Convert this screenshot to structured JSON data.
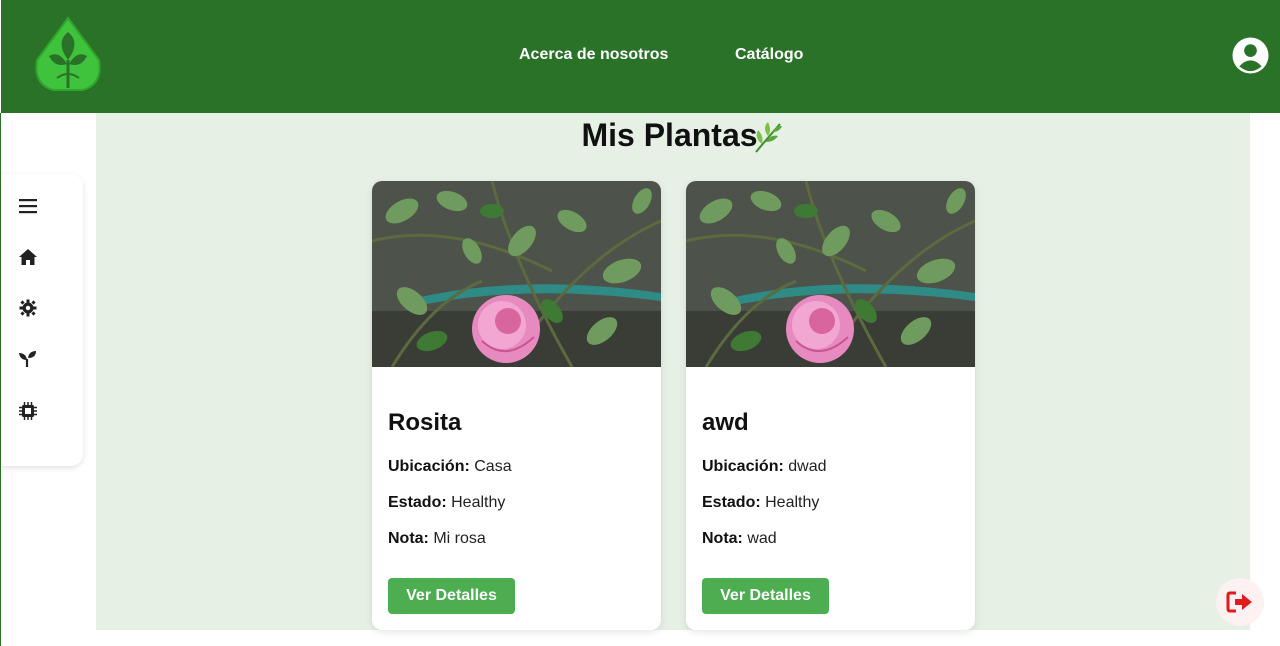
{
  "nav": {
    "about_label": "Acerca de nosotros",
    "catalog_label": "Catálogo"
  },
  "page": {
    "title": "Mis Plantas"
  },
  "sidebar": {
    "items": [
      {
        "icon": "menu-icon"
      },
      {
        "icon": "home-icon"
      },
      {
        "icon": "gear-icon"
      },
      {
        "icon": "sprout-icon"
      },
      {
        "icon": "chip-icon"
      }
    ]
  },
  "plants": [
    {
      "name": "Rosita",
      "location_label": "Ubicación:",
      "location": "Casa",
      "status_label": "Estado:",
      "status": "Healthy",
      "note_label": "Nota:",
      "note": "Mi rosa",
      "button_label": "Ver Detalles"
    },
    {
      "name": "awd",
      "location_label": "Ubicación:",
      "location": "dwad",
      "status_label": "Estado:",
      "status": "Healthy",
      "note_label": "Nota:",
      "note": "wad",
      "button_label": "Ver Detalles"
    }
  ],
  "colors": {
    "navbar": "#2b7229",
    "main_bg": "#e6f0e5",
    "button": "#4cae50",
    "logo": "#3fc33c",
    "logout": "#e01b1b"
  }
}
